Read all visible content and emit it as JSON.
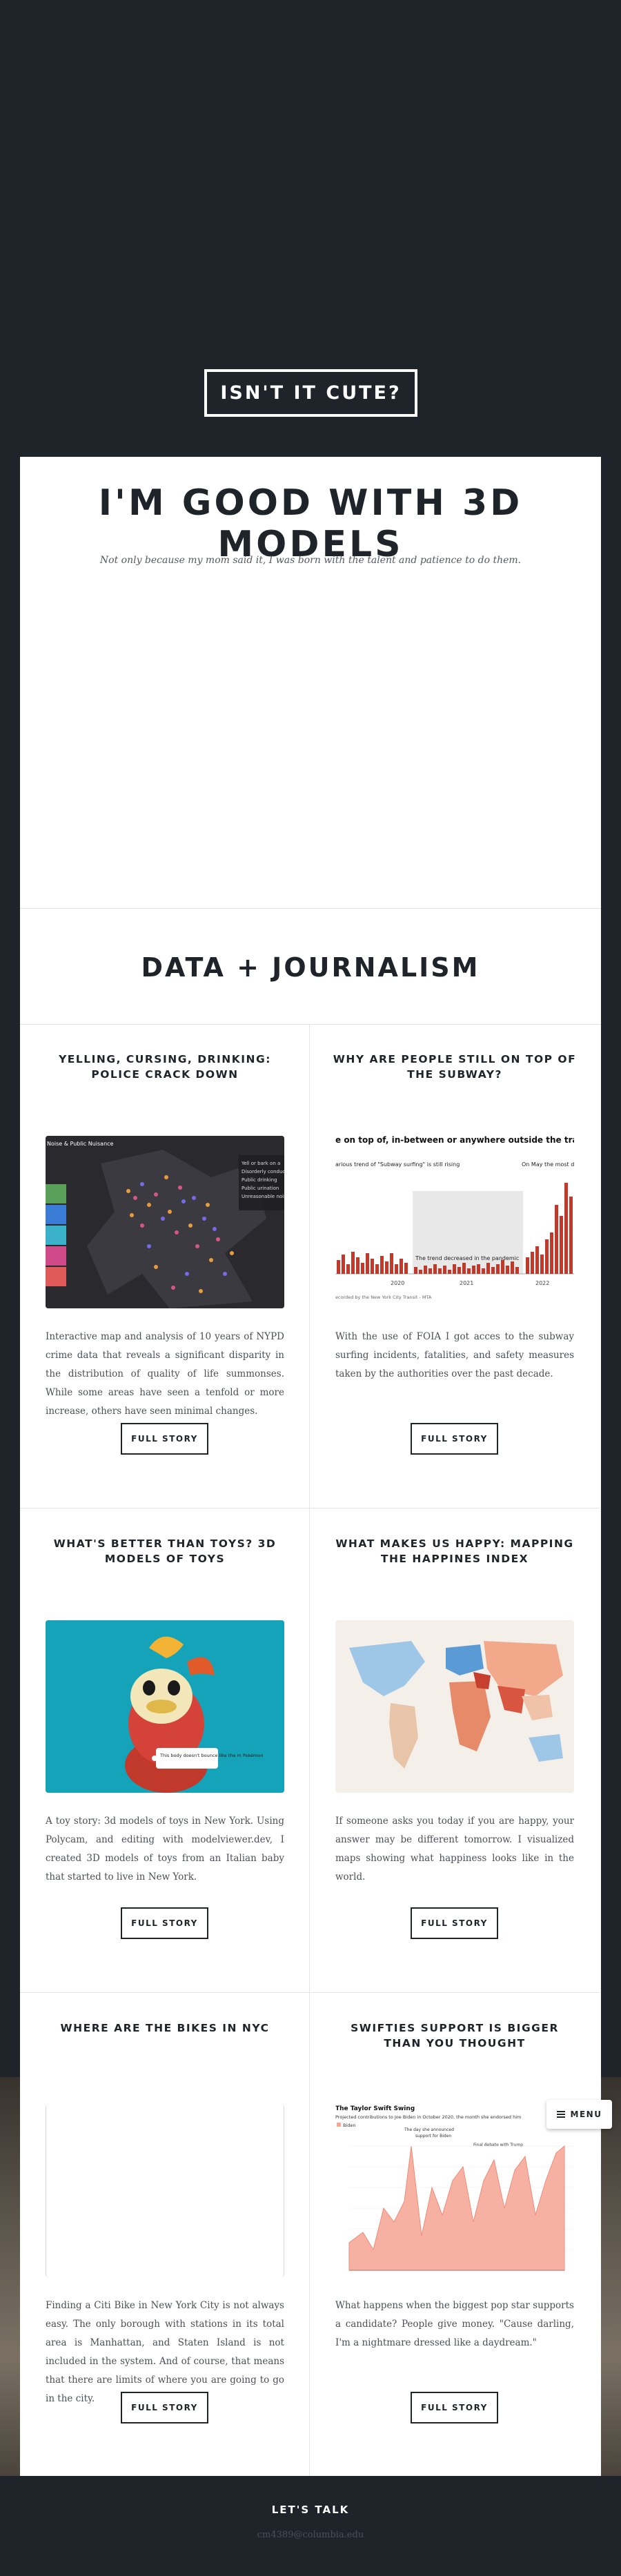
{
  "hero": {
    "button_label": "ISN'T IT CUTE?"
  },
  "intro": {
    "title": "I'M GOOD WITH 3D MODELS",
    "subtitle": "Not only because my mom said it, I was born with the talent and patience to do them."
  },
  "section": {
    "title": "DATA + JOURNALISM"
  },
  "cards": [
    {
      "title": "YELLING, CURSING, DRINKING: POLICE CRACK DOWN",
      "text": "Interactive map and analysis of 10 years of NYPD crime data that reveals a significant disparity in the distribution of quality of life summonses. While some areas have seen a tenfold or more increase, others have seen minimal changes.",
      "button": "FULL STORY",
      "thumb": {
        "legend": [
          "Yell or bark on a",
          "Disorderly conduct",
          "Public drinking",
          "Public urination",
          "Unreasonable noise"
        ],
        "label": "Noise & Public Nuisance"
      }
    },
    {
      "title": "WHY ARE PEOPLE STILL ON TOP OF THE SUBWAY?",
      "text": "With the use of FOIA I got acces to the subway surfing incidents, fatalities, and safety measures taken by the authorities over the past decade.",
      "button": "FULL STORY",
      "thumb": {
        "heading": "e on top of, in-between or anywhere outside the trai",
        "note_left": "arious trend of \"Subway surfing\" is still rising",
        "note_right": "On May the most d ancelwide was 'Su",
        "note_mid": "The trend decreased in the pandemic",
        "years": [
          "2020",
          "2021",
          "2022"
        ],
        "source": "ecorded by the New York City Transit - MTA"
      }
    },
    {
      "title": "WHAT'S BETTER THAN TOYS? 3D MODELS OF TOYS",
      "text": "A toy story: 3d models of toys in New York. Using Polycam, and editing with modelviewer.dev, I created 3D models of toys from an Italian baby that started to live in New York.",
      "button": "FULL STORY",
      "thumb": {
        "callout": "This body doesn't bounce like the m Pokémon"
      }
    },
    {
      "title": "WHAT MAKES US HAPPY: MAPPING THE HAPPINES INDEX",
      "text": "If someone asks you today if you are happy, your answer may be different tomorrow. I visualized maps showing what happiness looks like in the world.",
      "button": "FULL STORY"
    },
    {
      "title": "WHERE ARE THE BIKES IN NYC",
      "text": "Finding a Citi Bike in New York City is not always easy. The only borough with stations in its total area is Manhattan, and Staten Island is not included in the system. And of course, that means that there are limits of where you are going to go in the city.",
      "button": "FULL STORY"
    },
    {
      "title": "SWIFTIES SUPPORT IS BIGGER THAN YOU THOUGHT",
      "text": "What happens when the biggest pop star supports a candidate? People give money. \"Cause darling, I'm a nightmare dressed like a daydream.\"",
      "button": "FULL STORY",
      "thumb": {
        "heading": "The Taylor Swift Swing",
        "sub": "Projected contributions to Joe Biden in October 2020, the month she endorsed him",
        "legend": "Biden",
        "note1": "The day she announced",
        "note2": "support for Biden",
        "note3": "Final debate with Trump"
      }
    }
  ],
  "footer": {
    "title": "LET'S TALK",
    "email": "cm4389@columbia.edu"
  },
  "menu": {
    "label": "MENU"
  },
  "colors": {
    "dark": "#1f242b",
    "white": "#ffffff",
    "accent_red": "#c0392b",
    "toy_bg": "#14a3b8"
  }
}
